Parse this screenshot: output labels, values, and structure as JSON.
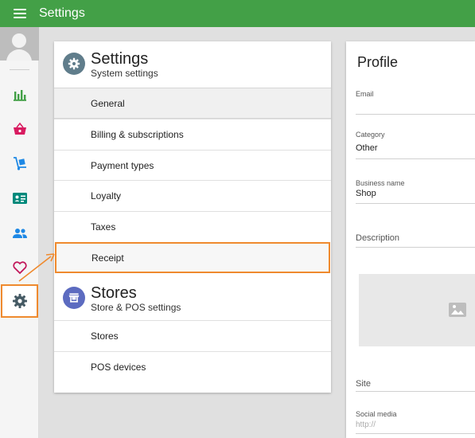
{
  "app": {
    "title": "Settings"
  },
  "sidebar": {
    "items": [
      {
        "name": "reports",
        "icon": "bar-chart-icon",
        "color": "#43a047"
      },
      {
        "name": "sales",
        "icon": "basket-icon",
        "color": "#d81b60"
      },
      {
        "name": "items",
        "icon": "dolly-icon",
        "color": "#1e88e5"
      },
      {
        "name": "employees",
        "icon": "id-card-icon",
        "color": "#00897b"
      },
      {
        "name": "customers",
        "icon": "people-icon",
        "color": "#1e88e5"
      },
      {
        "name": "loyalty",
        "icon": "heart-icon",
        "color": "#c2185b"
      },
      {
        "name": "settings",
        "icon": "gear-icon",
        "color": "#455a64",
        "active": true
      }
    ]
  },
  "settings_panel": {
    "section_title": "Settings",
    "section_subtitle": "System settings",
    "items": [
      "General",
      "Billing & subscriptions",
      "Payment types",
      "Loyalty",
      "Taxes",
      "Receipt"
    ],
    "stores_title": "Stores",
    "stores_subtitle": "Store & POS settings",
    "store_items": [
      "Stores",
      "POS devices"
    ]
  },
  "profile": {
    "title": "Profile",
    "email_label": "Email",
    "category_label": "Category",
    "category_value": "Other",
    "business_label": "Business name",
    "business_value": "Shop",
    "description_label": "Description",
    "site_label": "Site",
    "social_label": "Social media",
    "social_placeholder": "http://"
  },
  "colors": {
    "accent": "#43a047",
    "highlight": "#ef8a2e"
  }
}
